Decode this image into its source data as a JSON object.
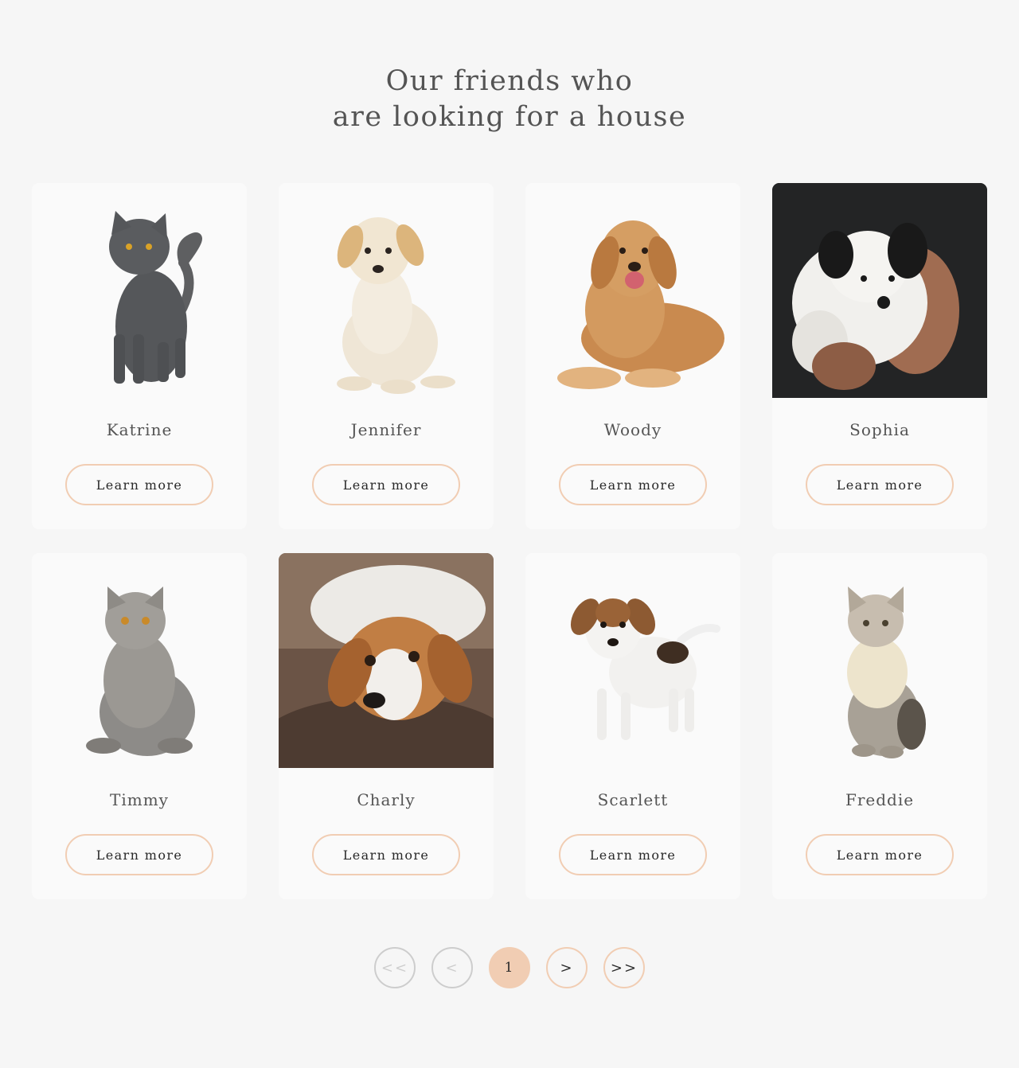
{
  "heading": {
    "line1": "Our friends who",
    "line2": "are looking for a house"
  },
  "pets": [
    {
      "name": "Katrine",
      "button": "Learn more",
      "photo": "gray-cat"
    },
    {
      "name": "Jennifer",
      "button": "Learn more",
      "photo": "cream-puppy"
    },
    {
      "name": "Woody",
      "button": "Learn more",
      "photo": "golden-retriever"
    },
    {
      "name": "Sophia",
      "button": "Learn more",
      "photo": "fluffy-puppy-in-hands"
    },
    {
      "name": "Timmy",
      "button": "Learn more",
      "photo": "british-shorthair-cat"
    },
    {
      "name": "Charly",
      "button": "Learn more",
      "photo": "beagle-resting"
    },
    {
      "name": "Scarlett",
      "button": "Learn more",
      "photo": "jack-russell-puppy"
    },
    {
      "name": "Freddie",
      "button": "Learn more",
      "photo": "tabby-kitten"
    }
  ],
  "pagination": {
    "first": "<<",
    "prev": "<",
    "current": "1",
    "next": ">",
    "last": ">>"
  },
  "colors": {
    "accent": "#f1cdb3",
    "background": "#f6f6f6",
    "card": "#fafafa",
    "text": "#545454",
    "disabled": "#cdcdcd"
  }
}
